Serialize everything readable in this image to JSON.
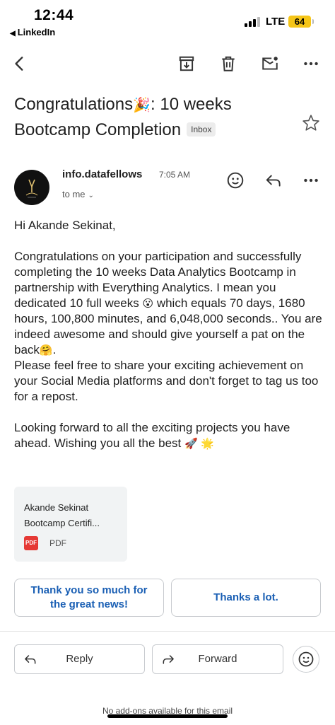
{
  "status_bar": {
    "time": "12:44",
    "back_app": "LinkedIn",
    "network": "LTE",
    "battery": "64"
  },
  "toolbar": {
    "icons": [
      "back-arrow-icon",
      "archive-icon",
      "delete-icon",
      "mark-unread-icon",
      "more-icon"
    ]
  },
  "email": {
    "subject_part1": "Congratulations",
    "subject_emoji": "🎉",
    "subject_part2": ": 10 weeks Bootcamp Completion",
    "label": "Inbox",
    "sender": "info.datafellows",
    "time": "7:05 AM",
    "recipient": "to me",
    "body": {
      "greeting": "Hi Akande Sekinat,",
      "p1_a": "Congratulations on your participation and successfully completing the 10 weeks Data Analytics Bootcamp in partnership with Everything Analytics. I mean you dedicated 10 full weeks ",
      "p1_emoji1": "😮",
      "p1_b": " which equals 70 days, 1680 hours, 100,800 minutes, and 6,048,000 seconds.. You are indeed awesome and should give yourself a pat on the back",
      "p1_emoji2": "🤗",
      "p1_c": ".",
      "p2": "Please feel free to share your exciting achievement on your Social Media platforms and don't forget to tag us too for a repost.",
      "p3_a": "Looking forward to all the exciting projects you have ahead. Wishing you all the best ",
      "p3_emoji": "🚀 🌟"
    },
    "attachment": {
      "line1": "Akande Sekinat",
      "line2": "Bootcamp Certifi...",
      "type": "PDF",
      "icon_text": "PDF"
    }
  },
  "smart_replies": [
    "Thank you so much for the great news!",
    "Thanks a lot."
  ],
  "reply_bar": {
    "reply": "Reply",
    "forward": "Forward"
  },
  "footer": "No add-ons available for this email",
  "colors": {
    "accent": "#1a5fb4",
    "battery": "#f5c518",
    "pdf": "#e53935"
  }
}
